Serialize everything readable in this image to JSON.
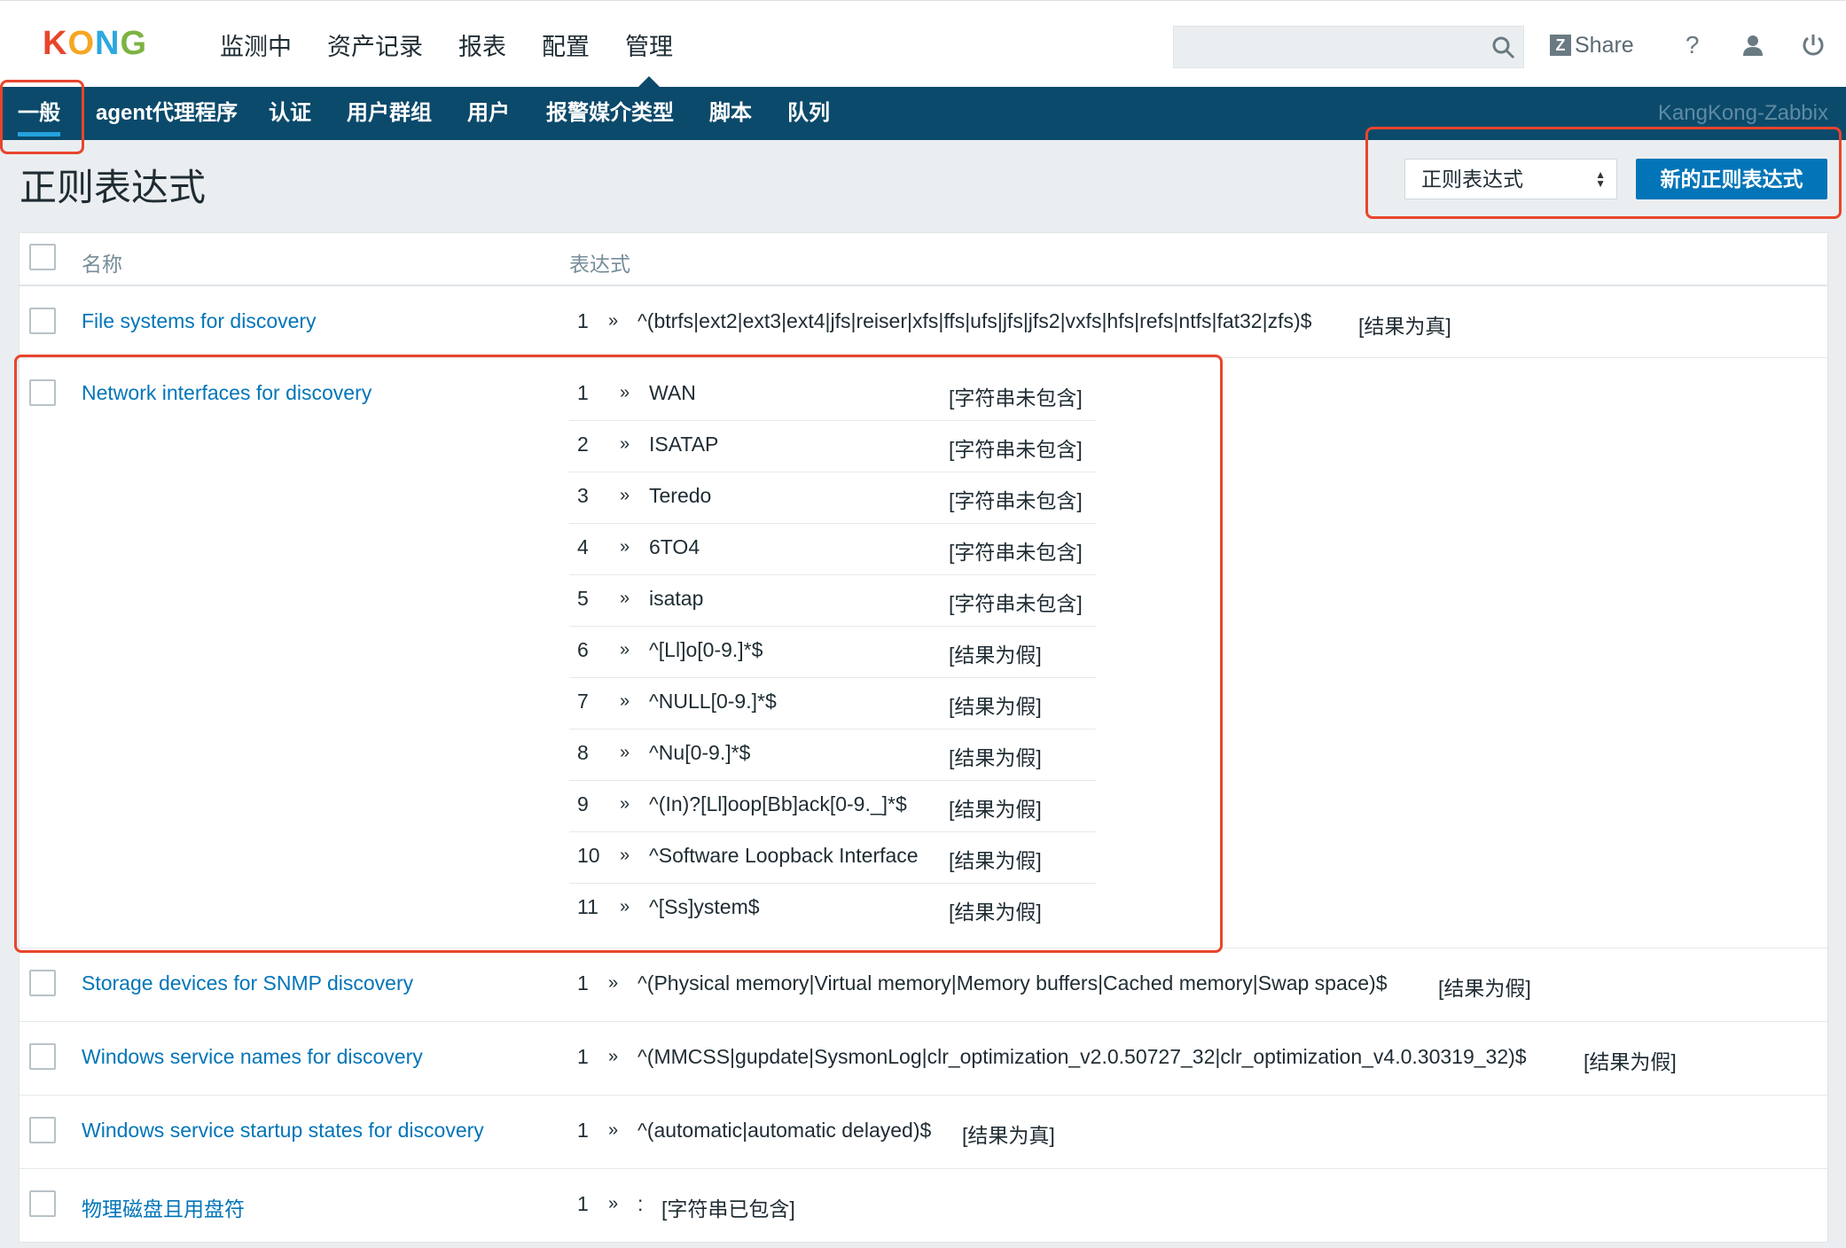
{
  "logo": {
    "text": "KONG",
    "letters": [
      {
        "ch": "K",
        "color": "#e8452c"
      },
      {
        "ch": "O",
        "color": "#f5a623"
      },
      {
        "ch": "N",
        "color": "#2ea7e0"
      },
      {
        "ch": "G",
        "color": "#7cb342"
      }
    ]
  },
  "main_nav": [
    "监测中",
    "资产记录",
    "报表",
    "配置",
    "管理"
  ],
  "main_nav_active": "管理",
  "header": {
    "share_label": "Share",
    "help_label": "?"
  },
  "sub_nav": [
    "一般",
    "agent代理程序",
    "认证",
    "用户群组",
    "用户",
    "报警媒介类型",
    "脚本",
    "队列"
  ],
  "brand": "KangKong-Zabbix",
  "page": {
    "title": "正则表达式",
    "select_value": "正则表达式",
    "new_button": "新的正则表达式"
  },
  "table": {
    "col_name": "名称",
    "col_expression": "表达式",
    "rows": [
      {
        "name": "File systems for discovery",
        "expressions": [
          {
            "num": "1",
            "sep": "»",
            "expr": "^(btrfs|ext2|ext3|ext4|jfs|reiser|xfs|ffs|ufs|jfs|jfs2|vxfs|hfs|refs|ntfs|fat32|zfs)$",
            "result": "[结果为真]"
          }
        ]
      },
      {
        "name": "Network interfaces for discovery",
        "expressions": [
          {
            "num": "1",
            "sep": "»",
            "expr": "WAN",
            "result": "[字符串未包含]"
          },
          {
            "num": "2",
            "sep": "»",
            "expr": "ISATAP",
            "result": "[字符串未包含]"
          },
          {
            "num": "3",
            "sep": "»",
            "expr": "Teredo",
            "result": "[字符串未包含]"
          },
          {
            "num": "4",
            "sep": "»",
            "expr": "6TO4",
            "result": "[字符串未包含]"
          },
          {
            "num": "5",
            "sep": "»",
            "expr": "isatap",
            "result": "[字符串未包含]"
          },
          {
            "num": "6",
            "sep": "»",
            "expr": "^[Ll]o[0-9.]*$",
            "result": "[结果为假]"
          },
          {
            "num": "7",
            "sep": "»",
            "expr": "^NULL[0-9.]*$",
            "result": "[结果为假]"
          },
          {
            "num": "8",
            "sep": "»",
            "expr": "^Nu[0-9.]*$",
            "result": "[结果为假]"
          },
          {
            "num": "9",
            "sep": "»",
            "expr": "^(In)?[Ll]oop[Bb]ack[0-9._]*$",
            "result": "[结果为假]"
          },
          {
            "num": "10",
            "sep": "»",
            "expr": "^Software Loopback Interface",
            "result": "[结果为假]"
          },
          {
            "num": "11",
            "sep": "»",
            "expr": "^[Ss]ystem$",
            "result": "[结果为假]"
          }
        ]
      },
      {
        "name": "Storage devices for SNMP discovery",
        "expressions": [
          {
            "num": "1",
            "sep": "»",
            "expr": "^(Physical memory|Virtual memory|Memory buffers|Cached memory|Swap space)$",
            "result": "[结果为假]"
          }
        ]
      },
      {
        "name": "Windows service names for discovery",
        "expressions": [
          {
            "num": "1",
            "sep": "»",
            "expr": "^(MMCSS|gupdate|SysmonLog|clr_optimization_v2.0.50727_32|clr_optimization_v4.0.30319_32)$",
            "result": "[结果为假]"
          }
        ]
      },
      {
        "name": "Windows service startup states for discovery",
        "expressions": [
          {
            "num": "1",
            "sep": "»",
            "expr": "^(automatic|automatic delayed)$",
            "result": "[结果为真]"
          }
        ]
      },
      {
        "name": "物理磁盘且用盘符",
        "expressions": [
          {
            "num": "1",
            "sep": "»",
            "expr": ":",
            "result": "[字符串已包含]"
          }
        ]
      }
    ]
  },
  "colors": {
    "nav_bg": "#0b4a6b",
    "link": "#0275b8",
    "highlight": "#e8452c",
    "button": "#0275b8"
  }
}
